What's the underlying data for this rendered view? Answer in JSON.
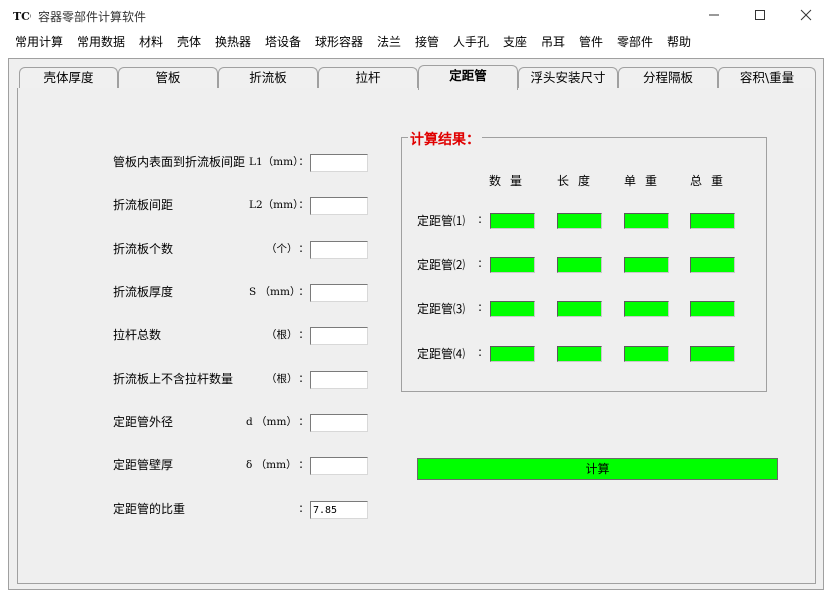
{
  "window": {
    "title": "容器零部件计算软件",
    "logo_text": "TCC"
  },
  "menu": [
    "常用计算",
    "常用数据",
    "材料",
    "壳体",
    "换热器",
    "塔设备",
    "球形容器",
    "法兰",
    "接管",
    "人手孔",
    "支座",
    "吊耳",
    "管件",
    "零部件",
    "帮助"
  ],
  "tabs": [
    "壳体厚度",
    "管板",
    "折流板",
    "拉杆",
    "定距管",
    "浮头安装尺寸",
    "分程隔板",
    "容积\\重量"
  ],
  "active_tab": "定距管",
  "inputs": [
    {
      "label": "管板内表面到折流板间距",
      "unit": "L1（mm）",
      "value": ""
    },
    {
      "label": "折流板间距",
      "unit": "L2（mm）",
      "value": ""
    },
    {
      "label": "折流板个数",
      "unit": "（个）",
      "value": ""
    },
    {
      "label": "折流板厚度",
      "unit": "S （mm）",
      "value": ""
    },
    {
      "label": "拉杆总数",
      "unit": "（根）",
      "value": ""
    },
    {
      "label": "折流板上不含拉杆数量",
      "unit": "（根）",
      "value": ""
    },
    {
      "label": "定距管外径",
      "unit": "d （mm）",
      "value": ""
    },
    {
      "label": "定距管壁厚",
      "unit": "δ （mm）",
      "value": ""
    },
    {
      "label": "定距管的比重",
      "unit": "",
      "value": "7.85"
    }
  ],
  "results": {
    "title": "计算结果：",
    "columns": [
      "数量",
      "长度",
      "单重",
      "总重"
    ],
    "rows": [
      "定距管⑴",
      "定距管⑵",
      "定距管⑶",
      "定距管⑷"
    ],
    "cell_color": "#00ff00"
  },
  "calc_button": "计算",
  "colors": {
    "result_title": "#e00000",
    "button": "#00ff00",
    "background": "#efefef"
  }
}
